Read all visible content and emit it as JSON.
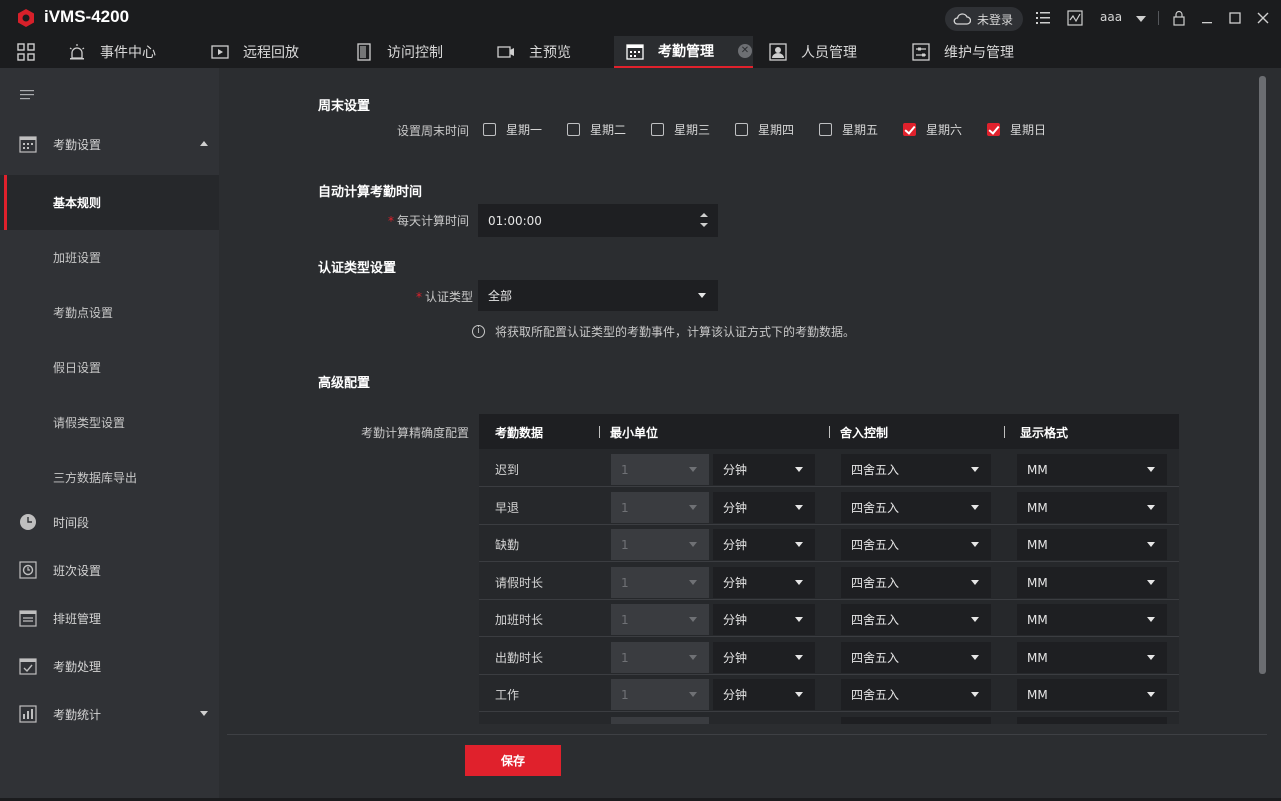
{
  "app": {
    "title": "iVMS-4200",
    "user": "aaa",
    "login_status": "未登录"
  },
  "colors": {
    "accent": "#e0212c",
    "background": "#2b2d30",
    "sidebar": "#303236",
    "titlebar": "#1b1c1e"
  },
  "tabs": [
    {
      "label": "事件中心",
      "icon": "alarm-light-icon"
    },
    {
      "label": "远程回放",
      "icon": "playback-icon"
    },
    {
      "label": "访问控制",
      "icon": "door-icon"
    },
    {
      "label": "主预览",
      "icon": "camera-icon"
    },
    {
      "label": "考勤管理",
      "icon": "calendar-icon",
      "active": true
    },
    {
      "label": "人员管理",
      "icon": "person-card-icon"
    },
    {
      "label": "维护与管理",
      "icon": "settings-sliders-icon"
    }
  ],
  "sidebar": {
    "items": [
      {
        "label": "考勤设置",
        "icon": "calendar-icon",
        "expanded": true
      },
      {
        "label": "时间段",
        "icon": "clock-icon"
      },
      {
        "label": "班次设置",
        "icon": "shift-icon"
      },
      {
        "label": "排班管理",
        "icon": "schedule-icon"
      },
      {
        "label": "考勤处理",
        "icon": "check-calendar-icon"
      },
      {
        "label": "考勤统计",
        "icon": "chart-icon"
      }
    ],
    "sub_items": [
      {
        "label": "基本规则",
        "active": true
      },
      {
        "label": "加班设置"
      },
      {
        "label": "考勤点设置"
      },
      {
        "label": "假日设置"
      },
      {
        "label": "请假类型设置"
      },
      {
        "label": "三方数据库导出"
      }
    ]
  },
  "weekend": {
    "title": "周末设置",
    "label": "设置周末时间",
    "days": [
      {
        "label": "星期一",
        "checked": false
      },
      {
        "label": "星期二",
        "checked": false
      },
      {
        "label": "星期三",
        "checked": false
      },
      {
        "label": "星期四",
        "checked": false
      },
      {
        "label": "星期五",
        "checked": false
      },
      {
        "label": "星期六",
        "checked": true
      },
      {
        "label": "星期日",
        "checked": true
      }
    ]
  },
  "auto_calc": {
    "title": "自动计算考勤时间",
    "label": "每天计算时间",
    "value": "01:00:00"
  },
  "auth": {
    "title": "认证类型设置",
    "label": "认证类型",
    "value": "全部",
    "hint": "将获取所配置认证类型的考勤事件，计算该认证方式下的考勤数据。"
  },
  "advanced": {
    "title": "高级配置",
    "label": "考勤计算精确度配置",
    "headers": {
      "data": "考勤数据",
      "min_unit": "最小单位",
      "rounding": "舍入控制",
      "format": "显示格式"
    },
    "rows": [
      {
        "name": "迟到",
        "min": "1",
        "unit": "分钟",
        "round": "四舍五入",
        "format": "MM"
      },
      {
        "name": "早退",
        "min": "1",
        "unit": "分钟",
        "round": "四舍五入",
        "format": "MM"
      },
      {
        "name": "缺勤",
        "min": "1",
        "unit": "分钟",
        "round": "四舍五入",
        "format": "MM"
      },
      {
        "name": "请假时长",
        "min": "1",
        "unit": "分钟",
        "round": "四舍五入",
        "format": "MM"
      },
      {
        "name": "加班时长",
        "min": "1",
        "unit": "分钟",
        "round": "四舍五入",
        "format": "MM"
      },
      {
        "name": "出勤时长",
        "min": "1",
        "unit": "分钟",
        "round": "四舍五入",
        "format": "MM"
      },
      {
        "name": "工作",
        "min": "1",
        "unit": "分钟",
        "round": "四舍五入",
        "format": "MM"
      }
    ]
  },
  "save_label": "保存"
}
